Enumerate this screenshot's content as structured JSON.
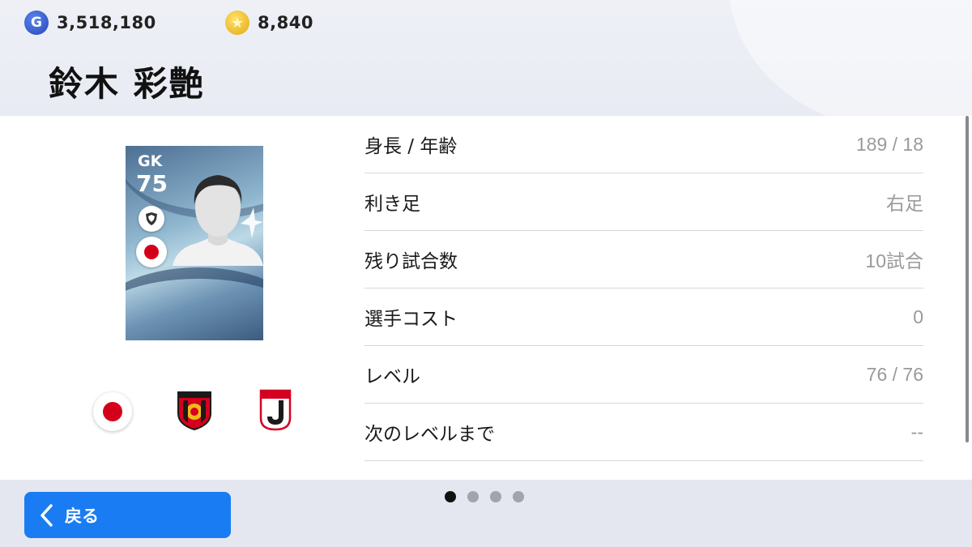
{
  "header": {
    "gp": {
      "icon": "gp-coin-icon",
      "icon_letter": "G",
      "value": "3,518,180"
    },
    "coins": {
      "icon": "star-coin-icon",
      "icon_glyph": "★",
      "value": "8,840"
    },
    "player_name": "鈴木 彩艶"
  },
  "card": {
    "position": "GK",
    "rating": "75",
    "badge_icon": "shield-badge-icon",
    "flag_icon": "japan-flag-icon"
  },
  "affiliations": [
    {
      "icon": "japan-flag-icon"
    },
    {
      "icon": "urawa-reds-crest-icon"
    },
    {
      "icon": "j-league-logo-icon"
    }
  ],
  "stats": [
    {
      "label": "身長 / 年齢",
      "value": "189 / 18"
    },
    {
      "label": "利き足",
      "value": "右足"
    },
    {
      "label": "残り試合数",
      "value": "10試合"
    },
    {
      "label": "選手コスト",
      "value": "0"
    },
    {
      "label": "レベル",
      "value": "76 / 76"
    },
    {
      "label": "次のレベルまで",
      "value": "--"
    }
  ],
  "footer": {
    "back_label": "戻る",
    "page_count": 4,
    "active_page": 1
  },
  "colors": {
    "accent": "#1a7cf2",
    "japan_red": "#d4001a",
    "urawa_red": "#d7001c",
    "gold": "#f0bb18"
  }
}
